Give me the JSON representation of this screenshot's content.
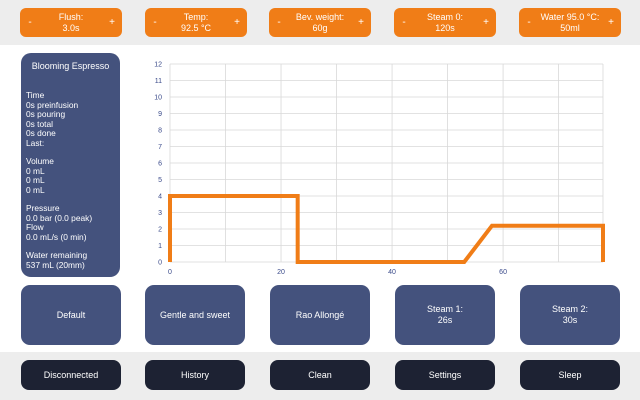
{
  "steppers": [
    {
      "dec": "-",
      "inc": "+",
      "line1": "Flush:",
      "line2": "3.0s"
    },
    {
      "dec": "-",
      "inc": "+",
      "line1": "Temp:",
      "line2": "92.5 °C"
    },
    {
      "dec": "-",
      "inc": "+",
      "line1": "Bev. weight:",
      "line2": "60g"
    },
    {
      "dec": "-",
      "inc": "+",
      "line1": "Steam 0:",
      "line2": "120s"
    },
    {
      "dec": "-",
      "inc": "+",
      "line1": "Water 95.0 °C:",
      "line2": "50ml"
    }
  ],
  "profile": {
    "title": "Blooming Espresso",
    "time_header": "Time",
    "preinfusion": "0s preinfusion",
    "pouring": "0s pouring",
    "total": "0s total",
    "done": "0s done",
    "last": "Last:",
    "volume_header": "Volume",
    "vol1": "0 mL",
    "vol2": "0 mL",
    "vol3": "0 mL",
    "pressure_header": "Pressure",
    "pressure_value": "0.0 bar (0.0 peak)",
    "flow_header": "Flow",
    "flow_value": "0.0 mL/s (0 min)",
    "water_header": "Water remaining",
    "water_value": "537 mL (20mm)"
  },
  "chart_data": {
    "type": "line",
    "xlim": [
      0,
      78
    ],
    "ylim": [
      0,
      12
    ],
    "xticks": [
      0,
      20,
      40,
      60
    ],
    "yticks": [
      0,
      1,
      2,
      3,
      4,
      5,
      6,
      7,
      8,
      9,
      10,
      11,
      12
    ],
    "grid": true,
    "color": "#f07d17",
    "series": [
      {
        "x": [
          0,
          0,
          23,
          23,
          53,
          58,
          78,
          78
        ],
        "y": [
          0,
          4,
          4,
          0,
          0,
          2.2,
          2.2,
          0
        ]
      }
    ]
  },
  "presets": [
    {
      "line1": "Default",
      "line2": ""
    },
    {
      "line1": "Gentle and sweet",
      "line2": ""
    },
    {
      "line1": "Rao Allongé",
      "line2": ""
    },
    {
      "line1": "Steam 1:",
      "line2": "26s"
    },
    {
      "line1": "Steam 2:",
      "line2": "30s"
    }
  ],
  "nav": {
    "disconnected": "Disconnected",
    "history": "History",
    "clean": "Clean",
    "settings": "Settings",
    "sleep": "Sleep"
  }
}
